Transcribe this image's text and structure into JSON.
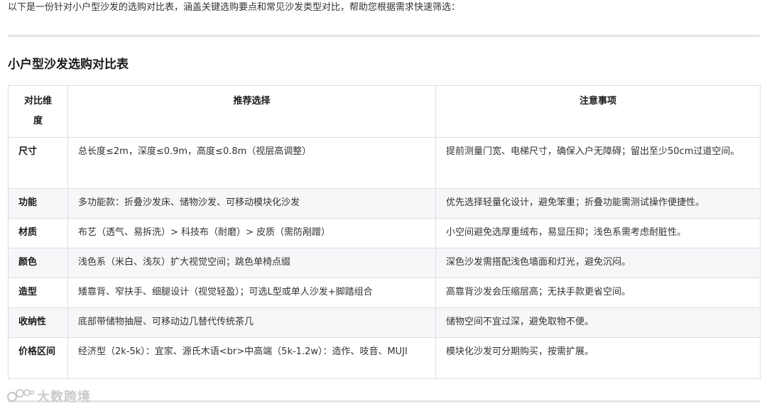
{
  "intro": "以下是一份针对小户型沙发的选购对比表，涵盖关键选购要点和常见沙发类型对比，帮助您根据需求快速筛选：",
  "heading": "小户型沙发选购对比表",
  "table": {
    "headers": [
      "对比维度",
      "推荐选择",
      "注意事项"
    ],
    "rows": [
      {
        "dimension": "尺寸",
        "recommend": "总长度≤2m，深度≤0.9m，高度≤0.8m（视层高调整）",
        "notes": "提前测量门宽、电梯尺寸，确保入户无障碍；留出至少50cm过道空间。"
      },
      {
        "dimension": "功能",
        "recommend": "多功能款：折叠沙发床、储物沙发、可移动模块化沙发",
        "notes": "优先选择轻量化设计，避免笨重；折叠功能需测试操作便捷性。"
      },
      {
        "dimension": "材质",
        "recommend": "布艺（透气、易拆洗）> 科技布（耐磨）> 皮质（需防剐蹭）",
        "notes": "小空间避免选厚重绒布，易显压抑；浅色系需考虑耐脏性。"
      },
      {
        "dimension": "颜色",
        "recommend": "浅色系（米白、浅灰）扩大视觉空间；跳色单椅点缀",
        "notes": "深色沙发需搭配浅色墙面和灯光，避免沉闷。"
      },
      {
        "dimension": "造型",
        "recommend": "矮靠背、窄扶手、细腿设计（视觉轻盈）；可选L型或单人沙发+脚踏组合",
        "notes": "高靠背沙发会压缩层高；无扶手款更省空间。"
      },
      {
        "dimension": "收纳性",
        "recommend": "底部带储物抽屉、可移动边几替代传统茶几",
        "notes": "储物空间不宜过深，避免取物不便。"
      },
      {
        "dimension": "价格区间",
        "recommend": "经济型（2k-5k）：宜家、源氏木语<br>中高端（5k-1.2w）：造作、吱音、MUJI",
        "notes": "模块化沙发可分期购买，按需扩展。"
      }
    ]
  },
  "watermark": {
    "icon": "brand-logo-icon",
    "text": "大数跨境"
  }
}
